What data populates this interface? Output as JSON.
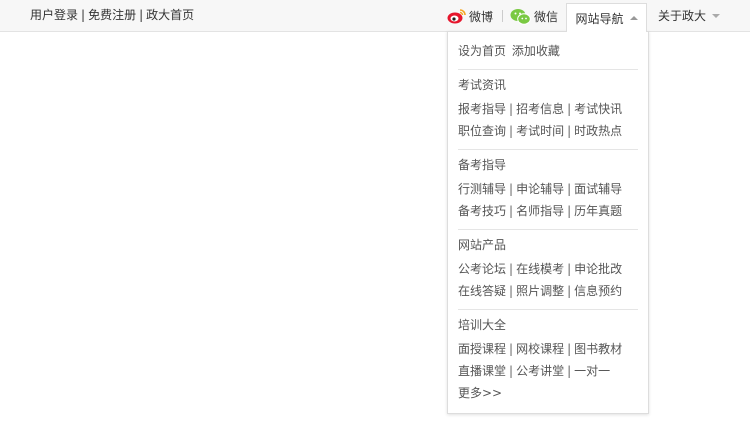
{
  "topbar": {
    "left_links": [
      "用户登录",
      "免费注册",
      "政大首页"
    ],
    "separator": "|",
    "weibo_label": "微博",
    "weixin_label": "微信",
    "nav_label": "网站导航",
    "about_label": "关于政大"
  },
  "dropdown": {
    "home": [
      "设为首页",
      "添加收藏"
    ],
    "sections": [
      {
        "title": "考试资讯",
        "rows": [
          [
            "报考指导",
            "招考信息",
            "考试快讯"
          ],
          [
            "职位查询",
            "考试时间",
            "时政热点"
          ]
        ]
      },
      {
        "title": "备考指导",
        "rows": [
          [
            "行测辅导",
            "申论辅导",
            "面试辅导"
          ],
          [
            "备考技巧",
            "名师指导",
            "历年真题"
          ]
        ]
      },
      {
        "title": "网站产品",
        "rows": [
          [
            "公考论坛",
            "在线模考",
            "申论批改"
          ],
          [
            "在线答疑",
            "照片调整",
            "信息预约"
          ]
        ]
      },
      {
        "title": "培训大全",
        "rows": [
          [
            "面授课程",
            "网校课程",
            "图书教材"
          ],
          [
            "直播课堂",
            "公考讲堂",
            "一对一"
          ]
        ]
      }
    ],
    "more_label": "更多>>"
  },
  "colors": {
    "weibo_red": "#e6162d",
    "weibo_yellow": "#f5a623",
    "weixin_green": "#7ac943"
  }
}
